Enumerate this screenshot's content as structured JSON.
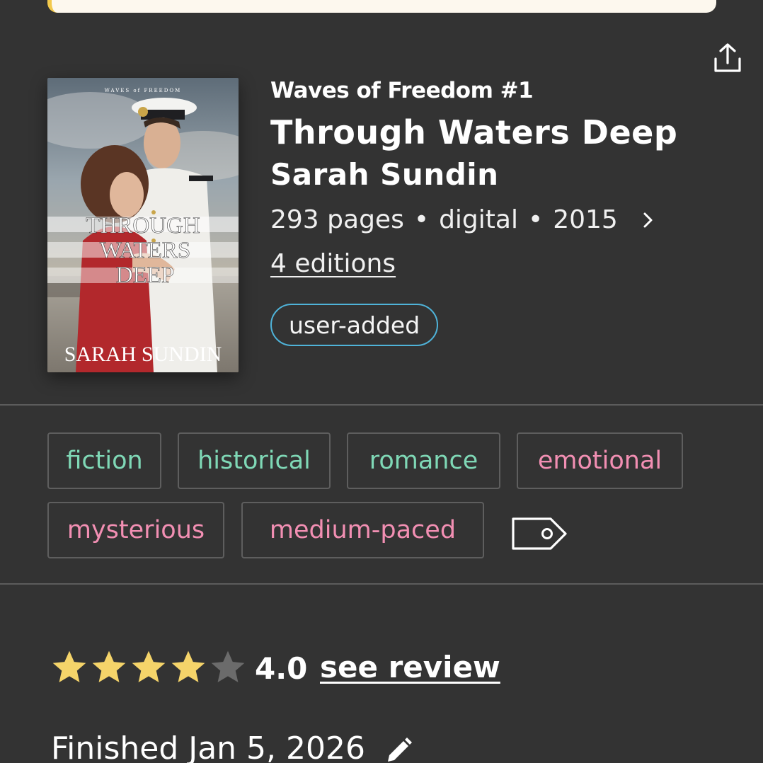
{
  "book": {
    "series": "Waves of Freedom #1",
    "title": "Through Waters Deep",
    "author": "Sarah Sundin",
    "meta": {
      "pages": "293 pages",
      "format": "digital",
      "year": "2015"
    },
    "editions_link": "4 editions",
    "source_badge": "user-added"
  },
  "cover": {
    "series_text": "WAVES of FREEDOM",
    "title_lines": [
      "THROUGH",
      "WATERS",
      "DEEP"
    ],
    "author_text": "SARAH SUNDIN"
  },
  "tags": [
    {
      "label": "fiction",
      "color": "#7fd8b6"
    },
    {
      "label": "historical",
      "color": "#7fd8b6"
    },
    {
      "label": "romance",
      "color": "#7fd8b6"
    },
    {
      "label": "emotional",
      "color": "#f28fb3"
    },
    {
      "label": "mysterious",
      "color": "#f28fb3"
    },
    {
      "label": "medium-paced",
      "color": "#f28fb3"
    }
  ],
  "rating": {
    "stars_filled": 4,
    "stars_total": 5,
    "value": "4.0",
    "review_link": "see review"
  },
  "status": {
    "finished_text": "Finished Jan 5, 2026"
  },
  "colors": {
    "background": "#333333",
    "star_filled": "#f5d46a",
    "star_empty": "#6b6b6b",
    "badge_border": "#4fb3d9",
    "banner_accent": "#f2c94c"
  },
  "icons": {
    "share": "share-icon",
    "chevron": "chevron-right-icon",
    "tag": "tag-icon",
    "edit": "pencil-icon",
    "star": "star-icon"
  }
}
